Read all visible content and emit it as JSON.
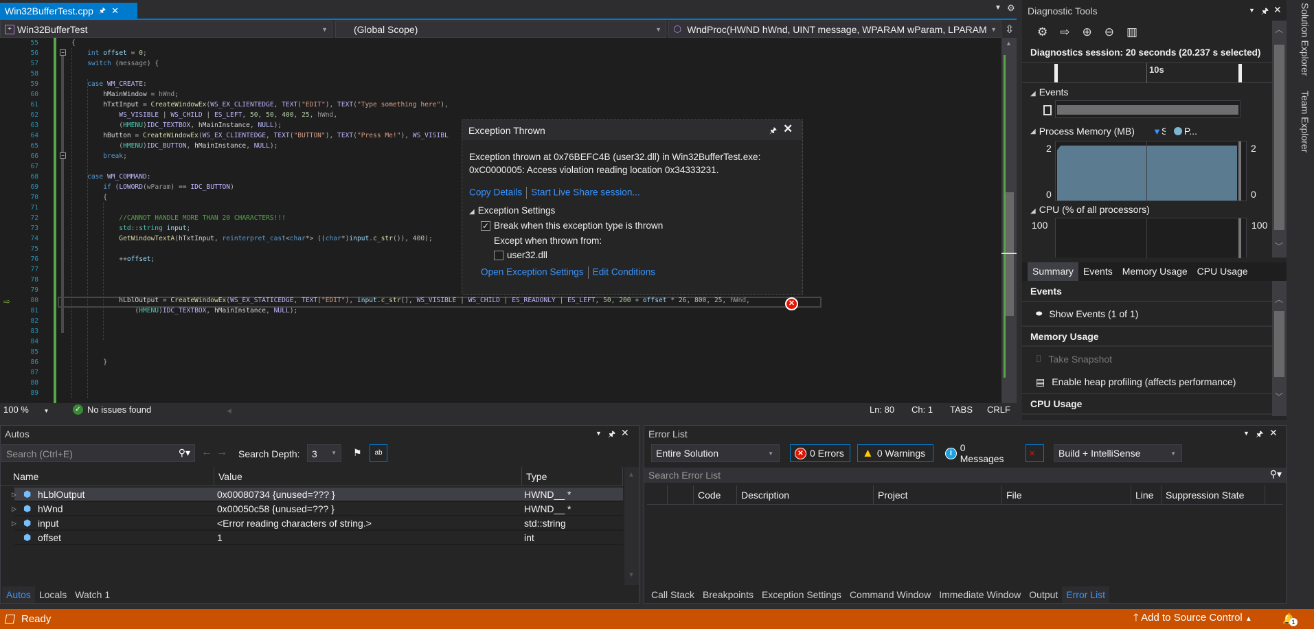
{
  "editor": {
    "tab": {
      "title": "Win32BufferTest.cpp",
      "pin_icon": "pin-icon",
      "close_icon": "close-icon"
    },
    "nav": {
      "project": "Win32BufferTest",
      "scope": "(Global Scope)",
      "function": "WndProc(HWND hWnd, UINT message, WPARAM wParam, LPARAM"
    },
    "current_line": 80,
    "lines": [
      {
        "n": "55",
        "t": [
          [
            "{",
            "o"
          ]
        ]
      },
      {
        "n": "56",
        "t": [
          [
            "    int",
            "k"
          ],
          [
            " offset",
            "v"
          ],
          [
            " = ",
            "o"
          ],
          [
            "0",
            "n"
          ],
          [
            ";",
            "o"
          ]
        ]
      },
      {
        "n": "57",
        "t": [
          [
            "    switch",
            "k"
          ],
          [
            " (",
            "o"
          ],
          [
            "message",
            "p"
          ],
          [
            ") {",
            "o"
          ]
        ]
      },
      {
        "n": "58",
        "t": []
      },
      {
        "n": "59",
        "t": [
          [
            "    case",
            "k"
          ],
          [
            " ",
            "o"
          ],
          [
            "WM_CREATE",
            "m"
          ],
          [
            ":",
            "o"
          ]
        ]
      },
      {
        "n": "60",
        "t": [
          [
            "        hMainWindow",
            "g"
          ],
          [
            " = ",
            "o"
          ],
          [
            "hWnd",
            "p"
          ],
          [
            ";",
            "o"
          ]
        ]
      },
      {
        "n": "61",
        "t": [
          [
            "        hTxtInput",
            "g"
          ],
          [
            " = ",
            "o"
          ],
          [
            "CreateWindowEx",
            "f"
          ],
          [
            "(",
            "o"
          ],
          [
            "WS_EX_CLIENTEDGE",
            "m"
          ],
          [
            ", ",
            "o"
          ],
          [
            "TEXT",
            "m"
          ],
          [
            "(",
            "o"
          ],
          [
            "\"EDIT\"",
            "s"
          ],
          [
            "), ",
            "o"
          ],
          [
            "TEXT",
            "m"
          ],
          [
            "(",
            "o"
          ],
          [
            "\"Type something here\"",
            "s"
          ],
          [
            "),",
            "o"
          ]
        ]
      },
      {
        "n": "62",
        "t": [
          [
            "            WS_VISIBLE",
            "m"
          ],
          [
            " | ",
            "o"
          ],
          [
            "WS_CHILD",
            "m"
          ],
          [
            " | ",
            "o"
          ],
          [
            "ES_LEFT",
            "m"
          ],
          [
            ", ",
            "o"
          ],
          [
            "50",
            "n"
          ],
          [
            ", ",
            "o"
          ],
          [
            "50",
            "n"
          ],
          [
            ", ",
            "o"
          ],
          [
            "400",
            "n"
          ],
          [
            ", ",
            "o"
          ],
          [
            "25",
            "n"
          ],
          [
            ", ",
            "o"
          ],
          [
            "hWnd",
            "p"
          ],
          [
            ",",
            "o"
          ]
        ]
      },
      {
        "n": "63",
        "t": [
          [
            "            (",
            "o"
          ],
          [
            "HMENU",
            "t"
          ],
          [
            ")",
            "o"
          ],
          [
            "IDC_TEXTBOX",
            "m"
          ],
          [
            ", ",
            "o"
          ],
          [
            "hMainInstance",
            "g"
          ],
          [
            ", ",
            "o"
          ],
          [
            "NULL",
            "m"
          ],
          [
            ");",
            "o"
          ]
        ]
      },
      {
        "n": "64",
        "t": [
          [
            "        hButton",
            "g"
          ],
          [
            " = ",
            "o"
          ],
          [
            "CreateWindowEx",
            "f"
          ],
          [
            "(",
            "o"
          ],
          [
            "WS_EX_CLIENTEDGE",
            "m"
          ],
          [
            ", ",
            "o"
          ],
          [
            "TEXT",
            "m"
          ],
          [
            "(",
            "o"
          ],
          [
            "\"BUTTON\"",
            "s"
          ],
          [
            "), ",
            "o"
          ],
          [
            "TEXT",
            "m"
          ],
          [
            "(",
            "o"
          ],
          [
            "\"Press Me!\"",
            "s"
          ],
          [
            "), ",
            "o"
          ],
          [
            "WS_VISIBL",
            "m"
          ]
        ]
      },
      {
        "n": "65",
        "t": [
          [
            "            (",
            "o"
          ],
          [
            "HMENU",
            "t"
          ],
          [
            ")",
            "o"
          ],
          [
            "IDC_BUTTON",
            "m"
          ],
          [
            ", ",
            "o"
          ],
          [
            "hMainInstance",
            "g"
          ],
          [
            ", ",
            "o"
          ],
          [
            "NULL",
            "m"
          ],
          [
            ");",
            "o"
          ]
        ]
      },
      {
        "n": "66",
        "t": [
          [
            "        break",
            "k"
          ],
          [
            ";",
            "o"
          ]
        ]
      },
      {
        "n": "67",
        "t": []
      },
      {
        "n": "68",
        "t": [
          [
            "    case",
            "k"
          ],
          [
            " ",
            "o"
          ],
          [
            "WM_COMMAND",
            "m"
          ],
          [
            ":",
            "o"
          ]
        ]
      },
      {
        "n": "69",
        "t": [
          [
            "        if",
            "k"
          ],
          [
            " (",
            "o"
          ],
          [
            "LOWORD",
            "m"
          ],
          [
            "(",
            "o"
          ],
          [
            "wParam",
            "p"
          ],
          [
            ") == ",
            "o"
          ],
          [
            "IDC_BUTTON",
            "m"
          ],
          [
            ")",
            "o"
          ]
        ]
      },
      {
        "n": "70",
        "t": [
          [
            "        {",
            "o"
          ]
        ]
      },
      {
        "n": "71",
        "t": []
      },
      {
        "n": "72",
        "t": [
          [
            "            //CANNOT HANDLE MORE THAN 20 CHARACTERS!!!",
            "c"
          ]
        ]
      },
      {
        "n": "73",
        "t": [
          [
            "            std",
            "t"
          ],
          [
            "::",
            "o"
          ],
          [
            "string",
            "t"
          ],
          [
            " ",
            "o"
          ],
          [
            "input",
            "v"
          ],
          [
            ";",
            "o"
          ]
        ]
      },
      {
        "n": "74",
        "t": [
          [
            "            GetWindowTextA",
            "f"
          ],
          [
            "(",
            "o"
          ],
          [
            "hTxtInput",
            "g"
          ],
          [
            ", ",
            "o"
          ],
          [
            "reinterpret_cast",
            "k"
          ],
          [
            "<",
            "o"
          ],
          [
            "char",
            "k"
          ],
          [
            "*> ((",
            "o"
          ],
          [
            "char",
            "k"
          ],
          [
            "*)",
            "o"
          ],
          [
            "input",
            "v"
          ],
          [
            ".",
            "o"
          ],
          [
            "c_str",
            "f"
          ],
          [
            "()), ",
            "o"
          ],
          [
            "400",
            "n"
          ],
          [
            ");",
            "o"
          ]
        ]
      },
      {
        "n": "75",
        "t": []
      },
      {
        "n": "76",
        "t": [
          [
            "            ++",
            "o"
          ],
          [
            "offset",
            "v"
          ],
          [
            ";",
            "o"
          ]
        ]
      },
      {
        "n": "77",
        "t": []
      },
      {
        "n": "78",
        "t": []
      },
      {
        "n": "79",
        "t": []
      },
      {
        "n": "80",
        "t": [
          [
            "            hLblOutput",
            "g"
          ],
          [
            " = ",
            "o"
          ],
          [
            "CreateWindowEx",
            "f"
          ],
          [
            "(",
            "o"
          ],
          [
            "WS_EX_STATICEDGE",
            "m"
          ],
          [
            ", ",
            "o"
          ],
          [
            "TEXT",
            "m"
          ],
          [
            "(",
            "o"
          ],
          [
            "\"EDIT\"",
            "s"
          ],
          [
            "), ",
            "o"
          ],
          [
            "input",
            "v"
          ],
          [
            ".",
            "o"
          ],
          [
            "c_str",
            "f"
          ],
          [
            "(), ",
            "o"
          ],
          [
            "WS_VISIBLE",
            "m"
          ],
          [
            " | ",
            "o"
          ],
          [
            "WS_CHILD",
            "m"
          ],
          [
            " | ",
            "o"
          ],
          [
            "ES_READONLY",
            "m"
          ],
          [
            " | ",
            "o"
          ],
          [
            "ES_LEFT",
            "m"
          ],
          [
            ", ",
            "o"
          ],
          [
            "50",
            "n"
          ],
          [
            ", ",
            "o"
          ],
          [
            "200",
            "n"
          ],
          [
            " + ",
            "o"
          ],
          [
            "offset",
            "v"
          ],
          [
            " * ",
            "o"
          ],
          [
            "26",
            "n"
          ],
          [
            ", ",
            "o"
          ],
          [
            "800",
            "n"
          ],
          [
            ", ",
            "o"
          ],
          [
            "25",
            "n"
          ],
          [
            ", ",
            "o"
          ],
          [
            "hWnd",
            "p"
          ],
          [
            ",",
            "o"
          ]
        ]
      },
      {
        "n": "81",
        "t": [
          [
            "                (",
            "o"
          ],
          [
            "HMENU",
            "t"
          ],
          [
            ")",
            "o"
          ],
          [
            "IDC_TEXTBOX",
            "m"
          ],
          [
            ", ",
            "o"
          ],
          [
            "hMainInstance",
            "g"
          ],
          [
            ", ",
            "o"
          ],
          [
            "NULL",
            "m"
          ],
          [
            ");",
            "o"
          ]
        ]
      },
      {
        "n": "82",
        "t": []
      },
      {
        "n": "83",
        "t": []
      },
      {
        "n": "84",
        "t": []
      },
      {
        "n": "85",
        "t": []
      },
      {
        "n": "86",
        "t": [
          [
            "        }",
            "o"
          ]
        ]
      },
      {
        "n": "87",
        "t": []
      },
      {
        "n": "88",
        "t": []
      },
      {
        "n": "89",
        "t": []
      }
    ],
    "status": {
      "zoom": "100 %",
      "issues": "No issues found",
      "ln": "Ln: 80",
      "ch": "Ch: 1",
      "tabs": "TABS",
      "eol": "CRLF"
    }
  },
  "exception": {
    "title": "Exception Thrown",
    "message_line1": "Exception thrown at 0x76BEFC4B (user32.dll) in Win32BufferTest.exe:",
    "message_line2": "0xC0000005: Access violation reading location 0x34333231.",
    "copy_details": "Copy Details",
    "live_share": "Start Live Share session...",
    "settings_header": "Exception Settings",
    "break_when": "Break when this exception type is thrown",
    "break_checked": true,
    "except_when": "Except when thrown from:",
    "module": "user32.dll",
    "module_checked": false,
    "open_settings": "Open Exception Settings",
    "edit_conditions": "Edit Conditions"
  },
  "diagnostic": {
    "title": "Diagnostic Tools",
    "session": "Diagnostics session: 20 seconds (20.237 s selected)",
    "ruler_label": "10s",
    "events_header": "Events",
    "memory_header": "Process Memory (MB)",
    "legend_snapshot": "S",
    "legend_private": "P...",
    "memory_max": "2",
    "memory_min": "0",
    "cpu_header": "CPU (% of all processors)",
    "cpu_max": "100",
    "tabs": [
      "Summary",
      "Events",
      "Memory Usage",
      "CPU Usage"
    ],
    "summary": {
      "events_title": "Events",
      "show_events": "Show Events (1 of 1)",
      "memory_title": "Memory Usage",
      "take_snapshot": "Take Snapshot",
      "heap_profiling": "Enable heap profiling (affects performance)",
      "cpu_title": "CPU Usage"
    },
    "colors": {
      "memory_fill": "#5B7C90",
      "legend_snapshot": "#3794FF",
      "legend_private": "#7EB4D0"
    }
  },
  "side_tabs": [
    "Solution Explorer",
    "Team Explorer"
  ],
  "autos": {
    "title": "Autos",
    "search_placeholder": "Search (Ctrl+E)",
    "search_depth_label": "Search Depth:",
    "search_depth": "3",
    "columns": [
      "Name",
      "Value",
      "Type"
    ],
    "rows": [
      {
        "name": "hLblOutput",
        "value": "0x00080734 {unused=??? }",
        "type": "HWND__ *",
        "expandable": true
      },
      {
        "name": "hWnd",
        "value": "0x00050c58 {unused=??? }",
        "type": "HWND__ *",
        "expandable": true
      },
      {
        "name": "input",
        "value": "<Error reading characters of string.>",
        "type": "std::string",
        "expandable": true
      },
      {
        "name": "offset",
        "value": "1",
        "type": "int",
        "expandable": false
      }
    ],
    "tabs": [
      "Autos",
      "Locals",
      "Watch 1"
    ]
  },
  "error_list": {
    "title": "Error List",
    "scope": "Entire Solution",
    "errors": "0 Errors",
    "warnings": "0 Warnings",
    "messages": "0 Messages",
    "source": "Build + IntelliSense",
    "search_placeholder": "Search Error List",
    "columns": [
      "Code",
      "Description",
      "Project",
      "File",
      "Line",
      "Suppression State"
    ],
    "tabs": [
      "Call Stack",
      "Breakpoints",
      "Exception Settings",
      "Command Window",
      "Immediate Window",
      "Output",
      "Error List"
    ]
  },
  "statusbar": {
    "ready": "Ready",
    "source_control": "Add to Source Control",
    "notifications": "1",
    "color": "#CA5100"
  }
}
